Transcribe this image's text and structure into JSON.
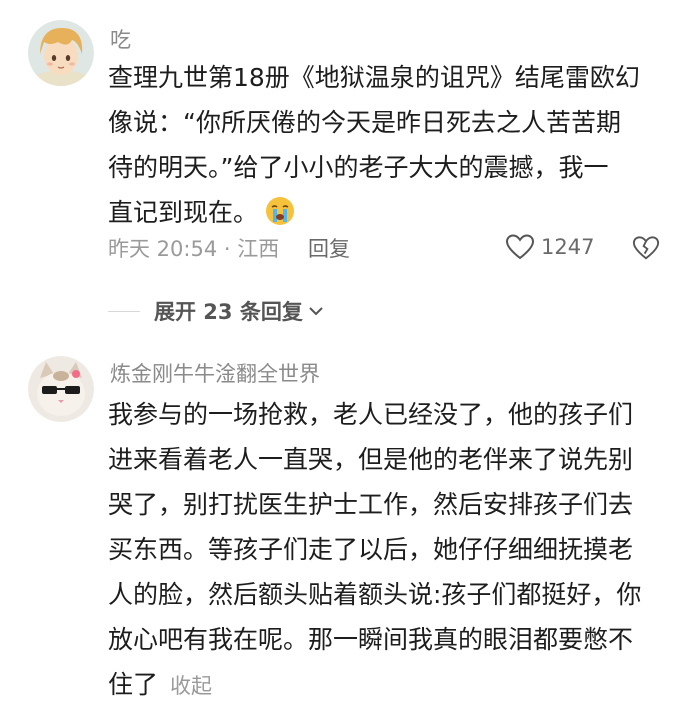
{
  "comments": [
    {
      "username": "吃",
      "avatar_icon": "anime-boy-avatar",
      "lines": [
        "查理九世第18册《地狱温泉的诅咒》结尾雷欧幻",
        "像说：“你所厌倦的今天是昨日死去之人苦苦期",
        "待的明天。”给了小小的老子大大的震撼，我一",
        "直记到现在。"
      ],
      "emoji": "crying-face-emoji",
      "meta": "昨天 20:54 · 江西",
      "reply_label": "回复",
      "like_count": "1247",
      "expand_label": "展开 23 条回复"
    },
    {
      "username": "炼金刚牛牛淦翻全世界",
      "avatar_icon": "cat-with-sunglasses-avatar",
      "lines": [
        "我参与的一场抢救，老人已经没了，他的孩子们",
        "进来看着老人一直哭，但是他的老伴来了说先别",
        "哭了，别打扰医生护士工作，然后安排孩子们去",
        "买东西。等孩子们走了以后，她仔仔细细抚摸老",
        "人的脸，然后额头贴着额头说:孩子们都挺好，你",
        "放心吧有我在呢。那一瞬间我真的眼泪都要憋不",
        "住了"
      ],
      "collapse_label": "收起"
    }
  ],
  "colors": {
    "text": "#1d1d1d",
    "muted": "#9a9a9a",
    "divider": "#d8d8d8"
  }
}
